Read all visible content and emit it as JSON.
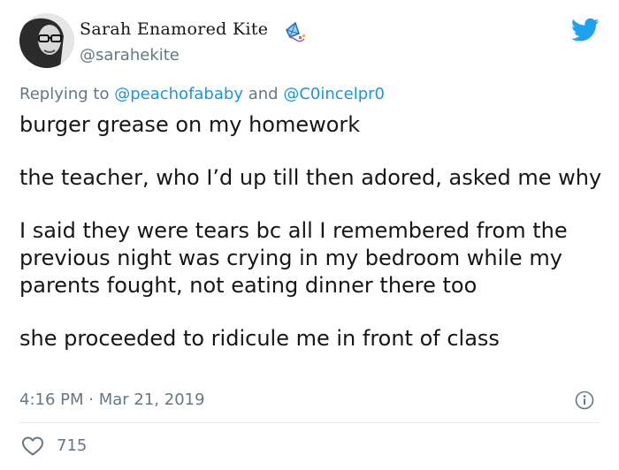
{
  "author": {
    "display_name": "Sarah Enamored Kite",
    "handle": "@sarahekite"
  },
  "reply": {
    "prefix": "Replying to",
    "mention_1": "@peachofababy",
    "joiner": "and",
    "mention_2": "@C0incelpr0"
  },
  "tweet": {
    "paragraphs": [
      "burger grease on my homework",
      "the teacher, who I’d up till then adored, asked me why",
      "I said they were tears bc all I remembered from the previous night was crying in my bedroom while my parents fought, not eating dinner there too",
      "she proceeded to ridicule me in front of class"
    ],
    "time": "4:16 PM",
    "separator": "·",
    "date": "Mar 21, 2019"
  },
  "engagement": {
    "likes": "715"
  },
  "icons": {
    "brand": "twitter-bird-icon",
    "decoration": "kite-icon",
    "info": "info-icon",
    "like": "heart-icon"
  },
  "colors": {
    "brand_blue": "#1da1f2",
    "link_blue": "#1b95e0",
    "muted_text": "#657786",
    "main_text": "#14171a",
    "divider": "#e1e8ed"
  }
}
